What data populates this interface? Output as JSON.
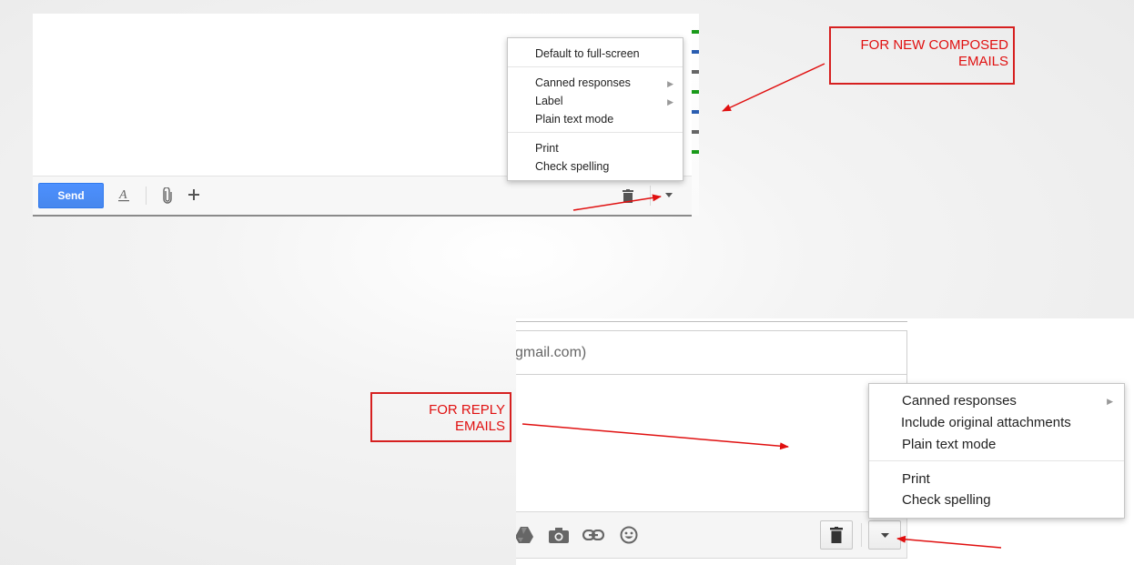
{
  "compose": {
    "send_label": "Send",
    "menu": {
      "items": [
        {
          "label": "Default to full-screen",
          "submenu": false
        },
        {
          "label": "Canned responses",
          "submenu": true
        },
        {
          "label": "Label",
          "submenu": true
        },
        {
          "label": "Plain text mode",
          "submenu": false
        },
        {
          "label": "Print",
          "submenu": false
        },
        {
          "label": "Check spelling",
          "submenu": false
        }
      ]
    },
    "icons": [
      "formatting-icon",
      "attach-icon",
      "plus-icon",
      "trash-icon",
      "dropdown-arrow-icon"
    ]
  },
  "reply": {
    "to_field_text": "gmail.com)",
    "menu": {
      "items": [
        {
          "label": "Canned responses",
          "submenu": true
        },
        {
          "label": "Include original attachments",
          "submenu": false
        },
        {
          "label": "Plain text mode",
          "submenu": false
        },
        {
          "label": "Print",
          "submenu": false
        },
        {
          "label": "Check spelling",
          "submenu": false
        }
      ]
    },
    "icons": [
      "drive-icon",
      "camera-icon",
      "link-icon",
      "emoji-icon",
      "trash-icon",
      "dropdown-arrow-icon"
    ]
  },
  "annotations": {
    "new_composed_line1": "FOR NEW COMPOSED",
    "new_composed_line2": "EMAILS",
    "reply_line1": "FOR REPLY",
    "reply_line2": "EMAILS"
  },
  "colors": {
    "annotation_red": "#e01010",
    "send_blue": "#4d90fe"
  }
}
